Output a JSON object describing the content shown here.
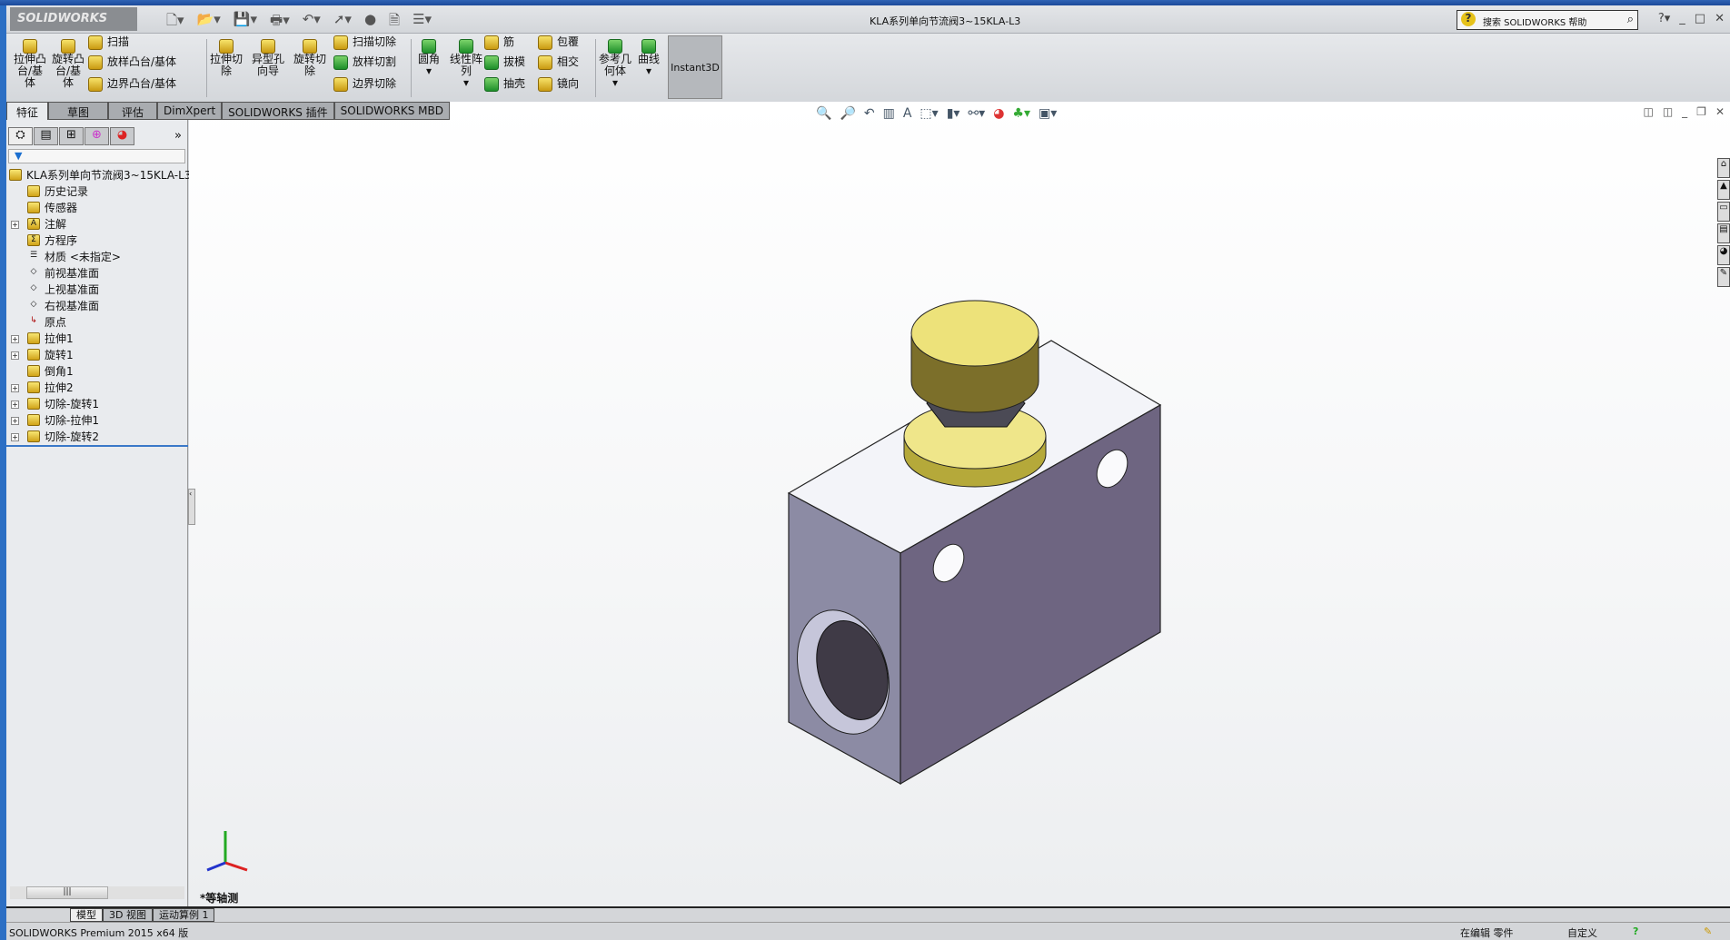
{
  "app": {
    "logo": "SOLIDWORKS",
    "title": "KLA系列单向节流阀3~15KLA-L3"
  },
  "search": {
    "placeholder": "搜索 SOLIDWORKS 帮助"
  },
  "ribbon": {
    "big": [
      "拉伸凸台/基体",
      "旋转凸台/基体",
      "拉伸切除",
      "异型孔向导",
      "旋转切除",
      "圆角",
      "线性阵列",
      "参考几何体",
      "曲线"
    ],
    "small": [
      "扫描",
      "放样凸台/基体",
      "边界凸台/基体",
      "扫描切除",
      "放样切割",
      "边界切除",
      "筋",
      "拔模",
      "抽壳",
      "包覆",
      "相交",
      "镜向"
    ],
    "instant3d": "Instant3D"
  },
  "tabs": [
    "特征",
    "草图",
    "评估",
    "DimXpert",
    "SOLIDWORKS 插件",
    "SOLIDWORKS MBD"
  ],
  "tree": {
    "root": "KLA系列单向节流阀3~15KLA-L3",
    "items": [
      "历史记录",
      "传感器",
      "注解",
      "方程序",
      "材质 <未指定>",
      "前视基准面",
      "上视基准面",
      "右视基准面",
      "原点",
      "拉伸1",
      "旋转1",
      "倒角1",
      "拉伸2",
      "切除-旋转1",
      "切除-拉伸1",
      "切除-旋转2"
    ]
  },
  "viewport": {
    "view_name": "*等轴测",
    "colors": {
      "block_top": "#f2f3f8",
      "block_left": "#8b8aa3",
      "block_right": "#6d6480",
      "knob": "#e6dc6a"
    }
  },
  "bottom_tabs": [
    "模型",
    "3D 视图",
    "运动算例 1"
  ],
  "status": {
    "left": "SOLIDWORKS Premium 2015 x64 版",
    "editing": "在编辑 零件",
    "custom": "自定义"
  }
}
